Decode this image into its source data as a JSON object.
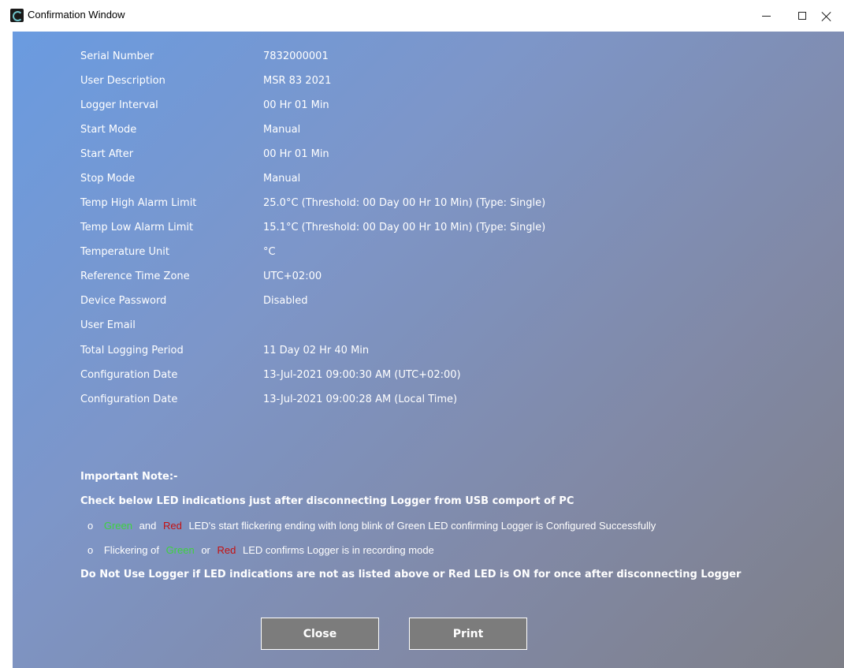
{
  "window": {
    "title": "Confirmation Window",
    "icon": "app-logo-icon"
  },
  "fields": [
    {
      "label": "Serial Number",
      "value": "7832000001"
    },
    {
      "label": "User Description",
      "value": "MSR 83 2021"
    },
    {
      "label": "Logger Interval",
      "value": "00 Hr 01 Min"
    },
    {
      "label": "Start Mode",
      "value": "Manual"
    },
    {
      "label": "Start After",
      "value": "00 Hr 01 Min"
    },
    {
      "label": "Stop Mode",
      "value": "Manual"
    },
    {
      "label": "Temp High Alarm Limit",
      "value": "25.0°C (Threshold: 00 Day 00 Hr 10 Min) (Type: Single)"
    },
    {
      "label": "Temp Low Alarm Limit",
      "value": "15.1°C (Threshold: 00 Day 00 Hr 10 Min) (Type: Single)"
    },
    {
      "label": "Temperature Unit",
      "value": "°C"
    },
    {
      "label": "Reference Time Zone",
      "value": "UTC+02:00"
    },
    {
      "label": "Device Password",
      "value": "Disabled"
    },
    {
      "label": "User Email",
      "value": ""
    },
    {
      "label": "Total Logging Period",
      "value": "11 Day 02 Hr 40 Min"
    },
    {
      "label": "Configuration Date",
      "value": "13-Jul-2021 09:00:30 AM (UTC+02:00)"
    },
    {
      "label": "Configuration Date",
      "value": "13-Jul-2021 09:00:28 AM (Local Time)"
    }
  ],
  "note": {
    "heading": "Important Note:-",
    "instruction": "Check below LED indications just after disconnecting Logger from USB comport of PC",
    "bullet1": {
      "bullet": "o",
      "green": "Green",
      "and": "and",
      "red": "Red",
      "rest": "LED's start flickering ending with long blink of Green LED confirming Logger is Configured Successfully"
    },
    "bullet2": {
      "bullet": "o",
      "prefix": "Flickering of",
      "green": "Green",
      "or": "or",
      "red": "Red",
      "rest": "LED confirms Logger is in recording mode"
    },
    "warning": "Do Not Use Logger if LED indications are not as listed above or Red LED is ON for once after disconnecting Logger"
  },
  "buttons": {
    "close_label": "Close",
    "print_label": "Print"
  },
  "colors": {
    "led_green": "#3ed23e",
    "led_red": "#c51010",
    "button_bg": "#7c7c7c"
  }
}
